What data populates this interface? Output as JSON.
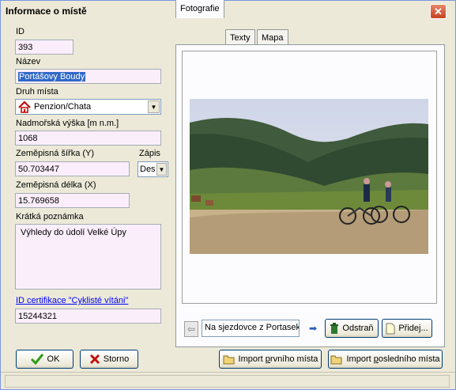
{
  "window": {
    "title": "Informace o místě",
    "close_glyph": "✕"
  },
  "form": {
    "id_label": "ID",
    "id_value": "393",
    "nazev_label": "Název",
    "nazev_value": "Portášovy Boudy",
    "druh_label": "Druh místa",
    "druh_value": "Penzion/Chata",
    "druh_icon": "house-icon",
    "vyska_label": "Nadmořská výška [m n.m.]",
    "vyska_value": "1068",
    "sirka_label": "Zeměpisná šířka (Y)",
    "sirka_value": "50.703447",
    "zapis_label": "Zápis",
    "zapis_value": "Des",
    "delka_label": "Zeměpisná délka (X)",
    "delka_value": "15.769658",
    "poznamka_label": "Krátká poznámka",
    "poznamka_value": "Výhledy do údolí Velké Úpy",
    "cert_link": "ID certifikace \"Cyklisté vítáni\"",
    "cert_value": "15244321"
  },
  "tabs": [
    "Fotografie",
    "Texty",
    "Mapa"
  ],
  "photo": {
    "caption": "Na sjezdovce z Portasek.",
    "prev_glyph": "⇦",
    "next_glyph": "➡",
    "delete_label": "Odstraň",
    "delete_icon": "trash-icon",
    "add_label": "Přidej...",
    "add_icon": "new-document-icon"
  },
  "buttons": {
    "ok_label": "OK",
    "ok_icon": "checkmark-icon",
    "storno_label": "Storno",
    "storno_icon": "x-icon",
    "import_first_pre": "Import ",
    "import_first_u": "p",
    "import_first_post": "rvního místa",
    "import_last_pre": "Import ",
    "import_last_u": "p",
    "import_last_post": "osledního místa",
    "import_icon": "folder-open-icon"
  },
  "colors": {
    "accent_link": "#0000ff",
    "field_bg": "#fbeefb",
    "window_bg": "#ece9d8"
  }
}
